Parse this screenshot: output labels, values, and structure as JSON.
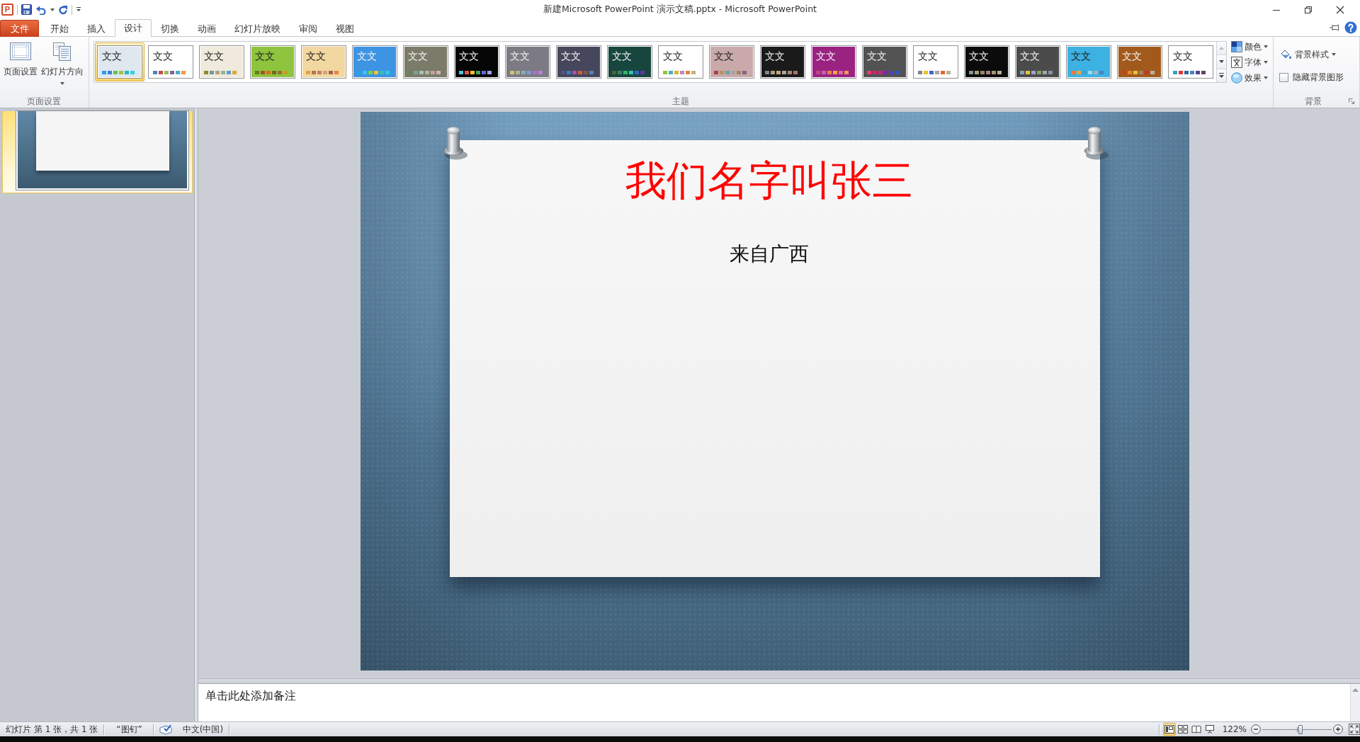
{
  "window": {
    "app_badge": "P",
    "title": "新建Microsoft PowerPoint 演示文稿.pptx - Microsoft PowerPoint"
  },
  "ribbon_tabs": [
    {
      "label": "文件",
      "kind": "file",
      "selected": false
    },
    {
      "label": "开始",
      "kind": "tab",
      "selected": false
    },
    {
      "label": "插入",
      "kind": "tab",
      "selected": false
    },
    {
      "label": "设计",
      "kind": "tab",
      "selected": true
    },
    {
      "label": "切换",
      "kind": "tab",
      "selected": false
    },
    {
      "label": "动画",
      "kind": "tab",
      "selected": false
    },
    {
      "label": "幻灯片放映",
      "kind": "tab",
      "selected": false
    },
    {
      "label": "审阅",
      "kind": "tab",
      "selected": false
    },
    {
      "label": "视图",
      "kind": "tab",
      "selected": false
    }
  ],
  "page_setup_group": {
    "label": "页面设置",
    "buttons": [
      {
        "label": "页面设置",
        "kind": "page_setup",
        "has_menu": false
      },
      {
        "label": "幻灯片方向",
        "kind": "orientation",
        "has_menu": true
      }
    ]
  },
  "themes_group": {
    "label": "主题",
    "scroll_up_disabled": true,
    "themes": [
      {
        "preview_text": "文文",
        "selected": true,
        "color": "#dfe7ef",
        "swatches": [
          {
            "color": "#2b9ee6"
          },
          {
            "color": "#3f7fd6"
          },
          {
            "color": "#5fc45a"
          },
          {
            "color": "#9bc53d"
          },
          {
            "color": "#2ab4c6"
          },
          {
            "color": "#28d6e3"
          }
        ]
      },
      {
        "preview_text": "文文",
        "selected": false,
        "color": "#ffffff",
        "swatches": [
          {
            "color": "#4f81bd"
          },
          {
            "color": "#c0504d"
          },
          {
            "color": "#9bbb59"
          },
          {
            "color": "#8064a2"
          },
          {
            "color": "#4bacc6"
          },
          {
            "color": "#f79646"
          }
        ]
      },
      {
        "preview_text": "文文",
        "selected": false,
        "color": "#efeadb",
        "swatches": [
          {
            "color": "#8c8a2c"
          },
          {
            "color": "#6e9a9a"
          },
          {
            "color": "#b4a27c"
          },
          {
            "color": "#93b39f"
          },
          {
            "color": "#5e9fc2"
          },
          {
            "color": "#e0a43c"
          }
        ]
      },
      {
        "preview_text": "文文",
        "selected": false,
        "color": "#8fc43e",
        "swatches": [
          {
            "color": "#5f7f1c"
          },
          {
            "color": "#9e5524"
          },
          {
            "color": "#d56f1e"
          },
          {
            "color": "#6b6b1f"
          },
          {
            "color": "#9f6a34"
          },
          {
            "color": "#c5a024"
          }
        ]
      },
      {
        "preview_text": "文文",
        "selected": false,
        "color": "#f2d8a0",
        "swatches": [
          {
            "color": "#e3a344"
          },
          {
            "color": "#b47250"
          },
          {
            "color": "#c3806c"
          },
          {
            "color": "#d4a27e"
          },
          {
            "color": "#a46052"
          },
          {
            "color": "#e4843e"
          }
        ]
      },
      {
        "preview_text": "文文",
        "selected": false,
        "color": "#3d94e3",
        "swatches": [
          {
            "color": "#2aa2e4"
          },
          {
            "color": "#3cc2f0"
          },
          {
            "color": "#84cf45"
          },
          {
            "color": "#f2c244"
          },
          {
            "color": "#34c2b2"
          },
          {
            "color": "#24d2d2"
          }
        ]
      },
      {
        "preview_text": "文文",
        "selected": false,
        "color": "#7b7b69",
        "swatches": [
          {
            "color": "#6f8060"
          },
          {
            "color": "#7fa090"
          },
          {
            "color": "#a3c2c2"
          },
          {
            "color": "#b5b2a0"
          },
          {
            "color": "#c4a2a2"
          },
          {
            "color": "#d2b2b2"
          }
        ]
      },
      {
        "preview_text": "文文",
        "selected": false,
        "color": "#050505",
        "swatches": [
          {
            "color": "#44c2e2"
          },
          {
            "color": "#e25252"
          },
          {
            "color": "#f2c424"
          },
          {
            "color": "#44a464"
          },
          {
            "color": "#6464e2"
          },
          {
            "color": "#a2a2e2"
          }
        ]
      },
      {
        "preview_text": "文文",
        "selected": false,
        "color": "#7c7a82",
        "swatches": [
          {
            "color": "#d4c474"
          },
          {
            "color": "#b4b484"
          },
          {
            "color": "#74b4c4"
          },
          {
            "color": "#8494d4"
          },
          {
            "color": "#a474c4"
          },
          {
            "color": "#b484d4"
          }
        ]
      },
      {
        "preview_text": "文文",
        "selected": false,
        "color": "#46465c",
        "swatches": [
          {
            "color": "#525284"
          },
          {
            "color": "#3c7cb4"
          },
          {
            "color": "#a454a4"
          },
          {
            "color": "#c46434"
          },
          {
            "color": "#845454"
          },
          {
            "color": "#5484b4"
          }
        ]
      },
      {
        "preview_text": "文文",
        "selected": false,
        "color": "#17463f",
        "swatches": [
          {
            "color": "#526232"
          },
          {
            "color": "#328264"
          },
          {
            "color": "#34b464"
          },
          {
            "color": "#34c4b4"
          },
          {
            "color": "#3464c4"
          },
          {
            "color": "#6434a4"
          }
        ]
      },
      {
        "preview_text": "文文",
        "selected": false,
        "color": "#ffffff",
        "swatches": [
          {
            "color": "#9cc234"
          },
          {
            "color": "#44b4c4"
          },
          {
            "color": "#e4b424"
          },
          {
            "color": "#c484c4"
          },
          {
            "color": "#e48434"
          },
          {
            "color": "#c4b484"
          }
        ]
      },
      {
        "preview_text": "文文",
        "selected": false,
        "color": "#c9a9a9",
        "swatches": [
          {
            "color": "#a44444"
          },
          {
            "color": "#b49464"
          },
          {
            "color": "#64a4a4"
          },
          {
            "color": "#a4a4a4"
          },
          {
            "color": "#a48464"
          },
          {
            "color": "#846484"
          }
        ]
      },
      {
        "preview_text": "文文",
        "selected": false,
        "color": "#1a1a1a",
        "swatches": [
          {
            "color": "#848484"
          },
          {
            "color": "#a4a484"
          },
          {
            "color": "#c4a474"
          },
          {
            "color": "#a4a4a4"
          },
          {
            "color": "#a48474"
          },
          {
            "color": "#a47474"
          }
        ]
      },
      {
        "preview_text": "文文",
        "selected": false,
        "color": "#9a2382",
        "swatches": [
          {
            "color": "#c44484"
          },
          {
            "color": "#c464a4"
          },
          {
            "color": "#e48444"
          },
          {
            "color": "#f4a444"
          },
          {
            "color": "#e464a4"
          },
          {
            "color": "#f49464"
          }
        ]
      },
      {
        "preview_text": "文文",
        "selected": false,
        "color": "#525252",
        "swatches": [
          {
            "color": "#f43474"
          },
          {
            "color": "#d42464"
          },
          {
            "color": "#c42484"
          },
          {
            "color": "#8424a4"
          },
          {
            "color": "#4444c4"
          },
          {
            "color": "#3454c4"
          }
        ]
      },
      {
        "preview_text": "文文",
        "selected": false,
        "color": "#ffffff",
        "swatches": [
          {
            "color": "#848484"
          },
          {
            "color": "#e4c424"
          },
          {
            "color": "#4464c4"
          },
          {
            "color": "#a4a4a4"
          },
          {
            "color": "#e46434"
          },
          {
            "color": "#b4b494"
          }
        ]
      },
      {
        "preview_text": "文文",
        "selected": false,
        "color": "#0b0b0b",
        "swatches": [
          {
            "color": "#8494a4"
          },
          {
            "color": "#a4a474"
          },
          {
            "color": "#948474"
          },
          {
            "color": "#a48474"
          },
          {
            "color": "#a49474"
          },
          {
            "color": "#b4b494"
          }
        ]
      },
      {
        "preview_text": "文文",
        "selected": false,
        "color": "#4b4b4b",
        "swatches": [
          {
            "color": "#84a4b4"
          },
          {
            "color": "#e4c444"
          },
          {
            "color": "#a4a4c4"
          },
          {
            "color": "#84a464"
          },
          {
            "color": "#a4a4a4"
          },
          {
            "color": "#8494a4"
          }
        ]
      },
      {
        "preview_text": "文文",
        "selected": false,
        "color": "#3cb1e2",
        "swatches": [
          {
            "color": "#f47434"
          },
          {
            "color": "#f4a434"
          },
          {
            "color": "#34a4d4"
          },
          {
            "color": "#9ad8f0"
          },
          {
            "color": "#a4b4b4"
          },
          {
            "color": "#4484c4"
          }
        ]
      },
      {
        "preview_text": "文文",
        "selected": false,
        "color": "#a25a1c",
        "swatches": [
          {
            "color": "#c44424"
          },
          {
            "color": "#e48424"
          },
          {
            "color": "#e4c444"
          },
          {
            "color": "#a48464"
          },
          {
            "color": "#c43424"
          },
          {
            "color": "#b4b494"
          }
        ]
      },
      {
        "preview_text": "文文",
        "selected": false,
        "color": "#ffffff",
        "swatches": [
          {
            "color": "#34a4c4"
          },
          {
            "color": "#e43434"
          },
          {
            "color": "#3464a4"
          },
          {
            "color": "#4484c4"
          },
          {
            "color": "#544484"
          },
          {
            "color": "#644464"
          }
        ]
      }
    ],
    "options": [
      {
        "label": "颜色",
        "kind": "colors"
      },
      {
        "label": "字体",
        "kind": "fonts"
      },
      {
        "label": "效果",
        "kind": "effects"
      }
    ]
  },
  "background_group": {
    "label": "背景",
    "style_button": {
      "label": "背景样式"
    },
    "hide_graphics": {
      "label": "隐藏背景图形",
      "checked": false
    }
  },
  "slides_panel": {
    "slides": [
      {
        "selected": true
      }
    ]
  },
  "slide": {
    "title": "我们名字叫张三",
    "subtitle": "来自广西"
  },
  "notes": {
    "placeholder": "单击此处添加备注"
  },
  "status_bar": {
    "slide_info": "幻灯片 第 1 张，共 1 张",
    "theme_name": "“图钉”",
    "language": "中文(中国)",
    "views": [
      {
        "kind": "normal",
        "selected": true
      },
      {
        "kind": "sorter",
        "selected": false
      },
      {
        "kind": "reading",
        "selected": false
      },
      {
        "kind": "slideshow",
        "selected": false
      }
    ],
    "zoom": "122%",
    "zoom_slider": {
      "level": 0.55
    }
  }
}
